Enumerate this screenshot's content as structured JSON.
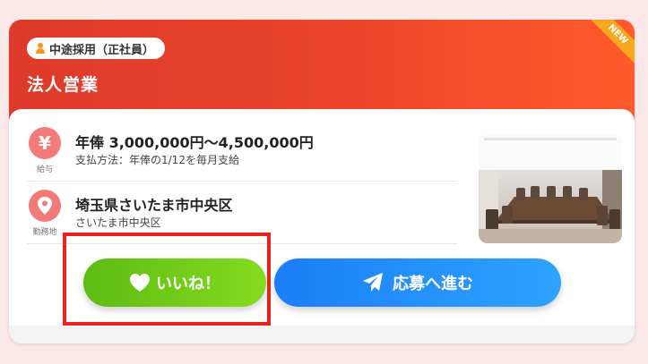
{
  "card": {
    "employment_type": "中途採用（正社員）",
    "job_title": "法人営業",
    "new_badge": "NEW"
  },
  "salary": {
    "icon_glyph": "¥",
    "caption": "給与",
    "amount": "年俸 3,000,000円～4,500,000円",
    "payment_method": "支払方法：年俸の1/12を毎月支給"
  },
  "location": {
    "caption": "勤務地",
    "address": "埼玉県さいたま市中央区",
    "sub": "さいたま市中央区"
  },
  "actions": {
    "like_label": "いいね！",
    "apply_label": "応募へ進む"
  },
  "colors": {
    "header_accent": "#e8432b",
    "like_green": "#6cc81a",
    "apply_blue": "#1f8cf8",
    "icon_pink": "#f27a79",
    "highlight_red": "#e52420"
  },
  "icons": [
    "person-icon",
    "yen-icon",
    "location-pin-icon",
    "heart-icon",
    "paper-plane-icon"
  ]
}
